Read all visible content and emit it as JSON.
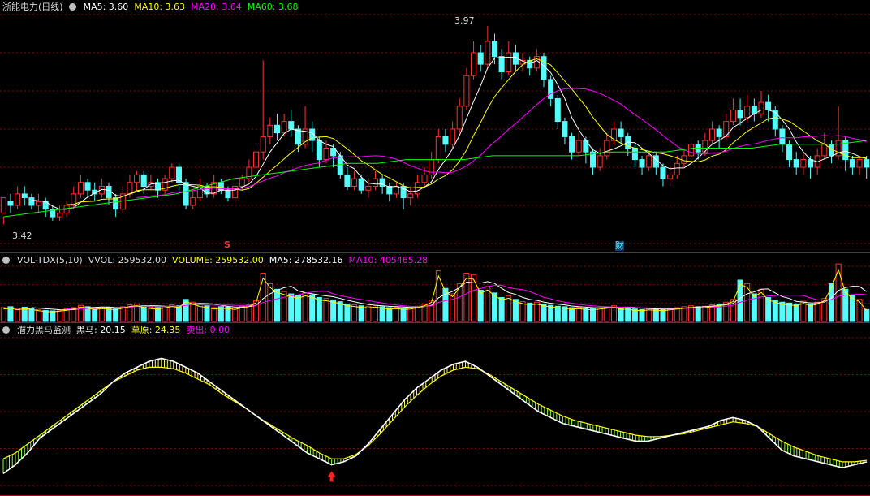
{
  "header": {
    "stock_name": "浙能电力(日线)",
    "ma_legend": [
      {
        "label": "MA5: 3.60",
        "color": "#ffffff"
      },
      {
        "label": "MA10: 3.63",
        "color": "#ffff00"
      },
      {
        "label": "MA20: 3.64",
        "color": "#ff00ff"
      },
      {
        "label": "MA60: 3.68",
        "color": "#00ff00"
      }
    ]
  },
  "price_panel": {
    "high_label": "3.97",
    "low_label": "3.42",
    "marker_s": "S",
    "marker_cai": "财"
  },
  "volume_panel": {
    "legend": [
      {
        "label": "VOL-TDX(5,10)",
        "color": "#dddddd"
      },
      {
        "label": "VVOL: 259532.00",
        "color": "#dddddd"
      },
      {
        "label": "VOLUME: 259532.00",
        "color": "#ffff00"
      },
      {
        "label": "MA5: 278532.16",
        "color": "#ffffff"
      },
      {
        "label": "MA10: 405465.28",
        "color": "#ff00ff"
      }
    ]
  },
  "indicator_panel": {
    "legend": [
      {
        "label": "潜力黑马监测",
        "color": "#dddddd"
      },
      {
        "label": "黑马: 20.15",
        "color": "#ffffff"
      },
      {
        "label": "草原: 24.35",
        "color": "#ffff00"
      },
      {
        "label": "卖出: 0.00",
        "color": "#ff00ff"
      }
    ]
  },
  "colors": {
    "up": "#ff3232",
    "down": "#54fcfc",
    "ma5": "#ffffff",
    "ma10": "#ffff00",
    "ma20": "#ff00ff",
    "ma60": "#00ff00",
    "grid": "#7a0a0a"
  },
  "chart_data": [
    {
      "type": "candlestick",
      "title": "浙能电力(日线)",
      "ylim": [
        3.4,
        4.0
      ],
      "candles": [
        [
          3.48,
          3.52,
          3.47,
          3.45
        ],
        [
          3.51,
          3.5,
          3.53,
          3.48
        ],
        [
          3.5,
          3.53,
          3.55,
          3.49
        ],
        [
          3.53,
          3.52,
          3.55,
          3.5
        ],
        [
          3.52,
          3.5,
          3.53,
          3.49
        ],
        [
          3.5,
          3.51,
          3.53,
          3.48
        ],
        [
          3.51,
          3.49,
          3.52,
          3.47
        ],
        [
          3.49,
          3.47,
          3.5,
          3.46
        ],
        [
          3.47,
          3.48,
          3.5,
          3.46
        ],
        [
          3.48,
          3.5,
          3.51,
          3.47
        ],
        [
          3.5,
          3.53,
          3.55,
          3.49
        ],
        [
          3.53,
          3.56,
          3.58,
          3.52
        ],
        [
          3.56,
          3.54,
          3.57,
          3.52
        ],
        [
          3.54,
          3.53,
          3.56,
          3.51
        ],
        [
          3.53,
          3.55,
          3.57,
          3.52
        ],
        [
          3.55,
          3.52,
          3.56,
          3.5
        ],
        [
          3.52,
          3.49,
          3.53,
          3.47
        ],
        [
          3.49,
          3.53,
          3.55,
          3.48
        ],
        [
          3.53,
          3.56,
          3.58,
          3.52
        ],
        [
          3.56,
          3.58,
          3.59,
          3.54
        ],
        [
          3.58,
          3.55,
          3.59,
          3.53
        ],
        [
          3.55,
          3.56,
          3.58,
          3.54
        ],
        [
          3.56,
          3.54,
          3.57,
          3.52
        ],
        [
          3.54,
          3.57,
          3.58,
          3.53
        ],
        [
          3.57,
          3.6,
          3.61,
          3.56
        ],
        [
          3.6,
          3.56,
          3.61,
          3.54
        ],
        [
          3.56,
          3.5,
          3.57,
          3.49
        ],
        [
          3.5,
          3.52,
          3.54,
          3.49
        ],
        [
          3.52,
          3.55,
          3.57,
          3.51
        ],
        [
          3.55,
          3.53,
          3.56,
          3.52
        ],
        [
          3.53,
          3.56,
          3.58,
          3.52
        ],
        [
          3.56,
          3.54,
          3.57,
          3.53
        ],
        [
          3.54,
          3.52,
          3.55,
          3.51
        ],
        [
          3.52,
          3.55,
          3.56,
          3.51
        ],
        [
          3.55,
          3.57,
          3.58,
          3.54
        ],
        [
          3.57,
          3.6,
          3.62,
          3.56
        ],
        [
          3.6,
          3.64,
          3.66,
          3.59
        ],
        [
          3.64,
          3.68,
          3.88,
          3.62
        ],
        [
          3.68,
          3.71,
          3.73,
          3.66
        ],
        [
          3.71,
          3.69,
          3.74,
          3.67
        ],
        [
          3.69,
          3.72,
          3.74,
          3.68
        ],
        [
          3.72,
          3.7,
          3.75,
          3.68
        ],
        [
          3.7,
          3.66,
          3.71,
          3.64
        ],
        [
          3.66,
          3.7,
          3.76,
          3.65
        ],
        [
          3.7,
          3.67,
          3.72,
          3.64
        ],
        [
          3.67,
          3.62,
          3.68,
          3.6
        ],
        [
          3.62,
          3.65,
          3.67,
          3.61
        ],
        [
          3.65,
          3.63,
          3.66,
          3.6
        ],
        [
          3.63,
          3.58,
          3.64,
          3.57
        ],
        [
          3.58,
          3.55,
          3.6,
          3.54
        ],
        [
          3.55,
          3.57,
          3.59,
          3.54
        ],
        [
          3.57,
          3.54,
          3.58,
          3.53
        ],
        [
          3.54,
          3.55,
          3.57,
          3.52
        ],
        [
          3.55,
          3.57,
          3.59,
          3.54
        ],
        [
          3.57,
          3.55,
          3.58,
          3.53
        ],
        [
          3.55,
          3.53,
          3.56,
          3.51
        ],
        [
          3.53,
          3.55,
          3.56,
          3.52
        ],
        [
          3.55,
          3.52,
          3.56,
          3.49
        ],
        [
          3.52,
          3.53,
          3.55,
          3.5
        ],
        [
          3.53,
          3.56,
          3.58,
          3.52
        ],
        [
          3.56,
          3.58,
          3.6,
          3.55
        ],
        [
          3.58,
          3.62,
          3.64,
          3.57
        ],
        [
          3.62,
          3.68,
          3.7,
          3.61
        ],
        [
          3.68,
          3.66,
          3.7,
          3.64
        ],
        [
          3.66,
          3.7,
          3.72,
          3.65
        ],
        [
          3.7,
          3.76,
          3.78,
          3.69
        ],
        [
          3.76,
          3.84,
          3.86,
          3.75
        ],
        [
          3.84,
          3.9,
          3.93,
          3.83
        ],
        [
          3.9,
          3.87,
          3.92,
          3.85
        ],
        [
          3.87,
          3.93,
          3.97,
          3.86
        ],
        [
          3.93,
          3.89,
          3.95,
          3.87
        ],
        [
          3.89,
          3.85,
          3.91,
          3.83
        ],
        [
          3.85,
          3.9,
          3.93,
          3.84
        ],
        [
          3.9,
          3.87,
          3.92,
          3.85
        ],
        [
          3.87,
          3.88,
          3.9,
          3.85
        ],
        [
          3.88,
          3.86,
          3.89,
          3.84
        ],
        [
          3.86,
          3.89,
          3.91,
          3.85
        ],
        [
          3.89,
          3.83,
          3.9,
          3.81
        ],
        [
          3.83,
          3.78,
          3.84,
          3.76
        ],
        [
          3.78,
          3.72,
          3.79,
          3.7
        ],
        [
          3.72,
          3.68,
          3.73,
          3.66
        ],
        [
          3.68,
          3.64,
          3.69,
          3.62
        ],
        [
          3.64,
          3.67,
          3.69,
          3.63
        ],
        [
          3.67,
          3.64,
          3.68,
          3.61
        ],
        [
          3.64,
          3.6,
          3.65,
          3.58
        ],
        [
          3.6,
          3.63,
          3.65,
          3.59
        ],
        [
          3.63,
          3.67,
          3.69,
          3.62
        ],
        [
          3.67,
          3.7,
          3.72,
          3.66
        ],
        [
          3.7,
          3.68,
          3.72,
          3.66
        ],
        [
          3.68,
          3.65,
          3.69,
          3.63
        ],
        [
          3.65,
          3.62,
          3.66,
          3.6
        ],
        [
          3.62,
          3.6,
          3.63,
          3.58
        ],
        [
          3.6,
          3.63,
          3.64,
          3.59
        ],
        [
          3.63,
          3.6,
          3.64,
          3.58
        ],
        [
          3.6,
          3.57,
          3.61,
          3.55
        ],
        [
          3.57,
          3.58,
          3.6,
          3.55
        ],
        [
          3.58,
          3.61,
          3.63,
          3.57
        ],
        [
          3.61,
          3.63,
          3.65,
          3.6
        ],
        [
          3.63,
          3.66,
          3.68,
          3.62
        ],
        [
          3.66,
          3.64,
          3.67,
          3.62
        ],
        [
          3.64,
          3.67,
          3.69,
          3.63
        ],
        [
          3.67,
          3.7,
          3.72,
          3.66
        ],
        [
          3.7,
          3.68,
          3.71,
          3.65
        ],
        [
          3.68,
          3.72,
          3.74,
          3.67
        ],
        [
          3.72,
          3.75,
          3.78,
          3.71
        ],
        [
          3.75,
          3.73,
          3.78,
          3.71
        ],
        [
          3.73,
          3.76,
          3.79,
          3.72
        ],
        [
          3.76,
          3.74,
          3.78,
          3.72
        ],
        [
          3.74,
          3.77,
          3.8,
          3.73
        ],
        [
          3.77,
          3.75,
          3.79,
          3.72
        ],
        [
          3.75,
          3.7,
          3.76,
          3.68
        ],
        [
          3.7,
          3.66,
          3.71,
          3.64
        ],
        [
          3.66,
          3.62,
          3.67,
          3.6
        ],
        [
          3.62,
          3.6,
          3.64,
          3.58
        ],
        [
          3.6,
          3.62,
          3.64,
          3.58
        ],
        [
          3.62,
          3.6,
          3.63,
          3.57
        ],
        [
          3.6,
          3.63,
          3.65,
          3.58
        ],
        [
          3.63,
          3.66,
          3.69,
          3.62
        ],
        [
          3.66,
          3.63,
          3.67,
          3.61
        ],
        [
          3.63,
          3.67,
          3.76,
          3.62
        ],
        [
          3.67,
          3.62,
          3.68,
          3.59
        ],
        [
          3.62,
          3.6,
          3.63,
          3.58
        ],
        [
          3.6,
          3.62,
          3.63,
          3.58
        ],
        [
          3.62,
          3.6,
          3.63,
          3.57
        ]
      ],
      "ma60": {
        "start_index": 0,
        "values": [
          3.47,
          3.48,
          3.49,
          3.5,
          3.51,
          3.52,
          3.53,
          3.55,
          3.57,
          3.58,
          3.59,
          3.6,
          3.61,
          3.61,
          3.62,
          3.62,
          3.62,
          3.63,
          3.63,
          3.63,
          3.63,
          3.64,
          3.64,
          3.64,
          3.65,
          3.65,
          3.65,
          3.66,
          3.66,
          3.66,
          3.67
        ]
      }
    },
    {
      "type": "bar",
      "title": "VOL-TDX(5,10)",
      "ylim": [
        0,
        1200000
      ],
      "values": [
        300000,
        320000,
        280000,
        310000,
        290000,
        260000,
        240000,
        230000,
        250000,
        270000,
        300000,
        350000,
        320000,
        290000,
        310000,
        300000,
        280000,
        320000,
        360000,
        380000,
        340000,
        310000,
        300000,
        330000,
        360000,
        340000,
        480000,
        420000,
        360000,
        340000,
        300000,
        320000,
        310000,
        290000,
        330000,
        360000,
        450000,
        1050000,
        820000,
        700000,
        650000,
        600000,
        560000,
        620000,
        580000,
        520000,
        500000,
        470000,
        430000,
        380000,
        360000,
        340000,
        330000,
        350000,
        320000,
        300000,
        310000,
        290000,
        300000,
        330000,
        380000,
        460000,
        1100000,
        720000,
        600000,
        820000,
        1050000,
        1020000,
        680000,
        760000,
        620000,
        520000,
        560000,
        480000,
        430000,
        400000,
        420000,
        380000,
        350000,
        330000,
        320000,
        300000,
        310000,
        290000,
        280000,
        300000,
        320000,
        340000,
        300000,
        290000,
        270000,
        260000,
        280000,
        270000,
        260000,
        280000,
        300000,
        320000,
        340000,
        320000,
        330000,
        360000,
        380000,
        420000,
        480000,
        900000,
        820000,
        600000,
        700000,
        520000,
        460000,
        420000,
        400000,
        380000,
        440000,
        380000,
        420000,
        500000,
        820000,
        1250000,
        700000,
        560000,
        480000,
        259532
      ],
      "ma5": [],
      "ma10": []
    },
    {
      "type": "line",
      "title": "潜力黑马监测",
      "ylim": [
        0,
        100
      ],
      "series": [
        {
          "name": "黑马",
          "color": "#ffffff",
          "values": [
            8,
            14,
            22,
            32,
            38,
            44,
            50,
            56,
            62,
            70,
            76,
            80,
            84,
            86,
            84,
            80,
            76,
            70,
            64,
            58,
            52,
            46,
            40,
            34,
            28,
            22,
            18,
            14,
            16,
            20,
            28,
            38,
            48,
            58,
            66,
            72,
            78,
            82,
            84,
            80,
            74,
            68,
            62,
            56,
            50,
            46,
            42,
            40,
            38,
            36,
            34,
            32,
            30,
            30,
            32,
            34,
            36,
            38,
            40,
            44,
            46,
            44,
            40,
            32,
            24,
            20,
            18,
            16,
            14,
            12,
            14,
            16
          ]
        },
        {
          "name": "草原",
          "color": "#ffff00",
          "values": [
            18,
            22,
            28,
            34,
            40,
            46,
            52,
            58,
            64,
            70,
            74,
            78,
            80,
            80,
            79,
            76,
            72,
            68,
            62,
            57,
            52,
            46,
            41,
            36,
            31,
            27,
            22,
            18,
            18,
            21,
            27,
            35,
            44,
            53,
            61,
            68,
            74,
            78,
            80,
            79,
            75,
            70,
            65,
            60,
            55,
            51,
            47,
            44,
            42,
            40,
            38,
            36,
            34,
            33,
            33,
            34,
            35,
            37,
            39,
            41,
            43,
            42,
            40,
            35,
            30,
            26,
            23,
            20,
            18,
            16,
            16,
            17
          ]
        }
      ],
      "buy_arrow_index": 27
    }
  ]
}
